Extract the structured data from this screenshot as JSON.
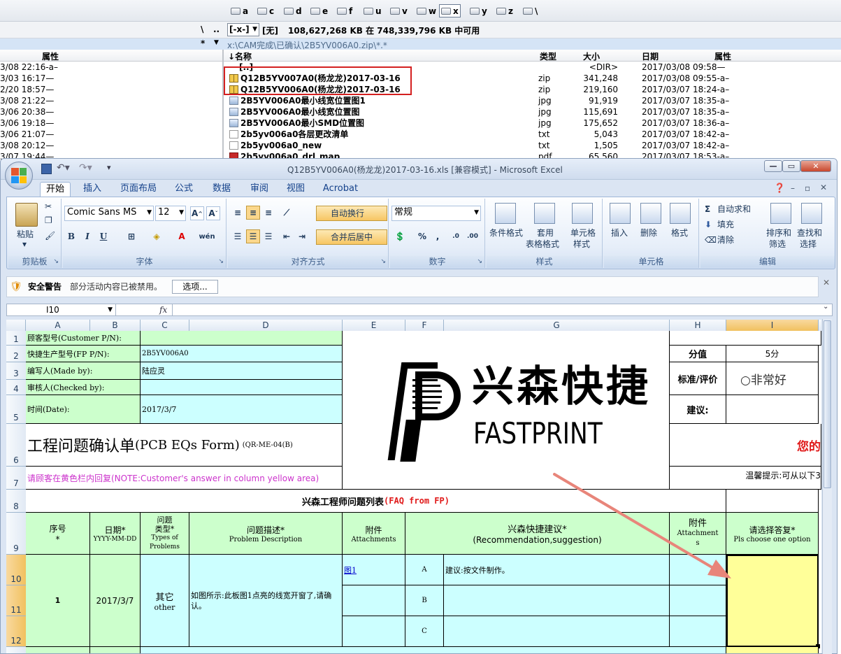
{
  "file_manager": {
    "drives": [
      "a",
      "c",
      "d",
      "e",
      "f",
      "u",
      "v",
      "w",
      "x",
      "y",
      "z",
      "\\"
    ],
    "selected_drive": "x",
    "left_path_labels": [
      "\\",
      "..",
      "*",
      "▼"
    ],
    "drive_selector": "[-x-]",
    "volume_label": "[无]",
    "free_space_text": "108,627,268 KB 在 748,339,796 KB 中可用",
    "current_path": "x:\\CAM完成\\已确认\\2B5YV006A0.zip\\*.*",
    "left_columns": {
      "attr": "属性"
    },
    "columns": {
      "name": "↓名称",
      "type": "类型",
      "size": "大小",
      "date": "日期",
      "attr": "属性"
    },
    "left_rows": [
      "3/08 22:16-a–",
      "3/03 16:17—",
      "2/20 18:57—",
      "3/08 21:22—",
      "3/06 20:38—",
      "3/06 19:18—",
      "3/06 21:07—",
      "3/08 20:12—",
      "3/07 19:44—"
    ],
    "rows": [
      {
        "name": "[..]",
        "type": "",
        "size": "<DIR>",
        "date": "2017/03/08 09:58—",
        "icon": "up"
      },
      {
        "name": "Q12B5YV007A0(杨龙龙)2017-03-16",
        "type": "zip",
        "size": "341,248",
        "date": "2017/03/08 09:55-a–",
        "icon": "zip"
      },
      {
        "name": "Q12B5YV006A0(杨龙龙)2017-03-16",
        "type": "zip",
        "size": "219,160",
        "date": "2017/03/07 18:24-a–",
        "icon": "zip"
      },
      {
        "name": "2B5YV006A0最小线宽位置图1",
        "type": "jpg",
        "size": "91,919",
        "date": "2017/03/07 18:35-a–",
        "icon": "jpg"
      },
      {
        "name": "2B5YV006A0最小线宽位置图",
        "type": "jpg",
        "size": "115,691",
        "date": "2017/03/07 18:35-a–",
        "icon": "jpg"
      },
      {
        "name": "2B5YV006A0最小SMD位置图",
        "type": "jpg",
        "size": "175,652",
        "date": "2017/03/07 18:36-a–",
        "icon": "jpg"
      },
      {
        "name": "2b5yv006a0各层更改清单",
        "type": "txt",
        "size": "5,043",
        "date": "2017/03/07 18:42-a–",
        "icon": "txt"
      },
      {
        "name": "2b5yv006a0_new",
        "type": "txt",
        "size": "1,505",
        "date": "2017/03/07 18:42-a–",
        "icon": "txt"
      },
      {
        "name": "2b5yv006a0_drl_map",
        "type": "pdf",
        "size": "65,560",
        "date": "2017/03/07 18:53-a–",
        "icon": "pdf"
      }
    ]
  },
  "excel": {
    "title": "Q12B5YV006A0(杨龙龙)2017-03-16.xls [兼容模式] - Microsoft Excel",
    "tabs": [
      "开始",
      "插入",
      "页面布局",
      "公式",
      "数据",
      "审阅",
      "视图",
      "Acrobat"
    ],
    "ribbon": {
      "clipboard": {
        "paste": "粘贴",
        "group": "剪贴板"
      },
      "font": {
        "name": "Comic Sans MS",
        "size": "12",
        "group": "字体"
      },
      "alignment": {
        "wrap": "自动换行",
        "merge": "合并后居中",
        "group": "对齐方式"
      },
      "number": {
        "format": "常规",
        "group": "数字"
      },
      "styles": {
        "cond": "条件格式",
        "table1": "套用",
        "table2": "表格格式",
        "cell1": "单元格",
        "cell2": "样式",
        "group": "样式"
      },
      "cells": {
        "insert": "插入",
        "delete": "删除",
        "format": "格式",
        "group": "单元格"
      },
      "editing": {
        "autosum": "自动求和",
        "fill": "填充",
        "clear": "清除",
        "sort1": "排序和",
        "sort2": "筛选",
        "find1": "查找和",
        "find2": "选择",
        "group": "编辑"
      }
    },
    "security": {
      "title": "安全警告",
      "message": "部分活动内容已被禁用。",
      "options": "选项..."
    },
    "name_box": "I10",
    "fx": "fx",
    "columns": [
      "A",
      "B",
      "C",
      "D",
      "E",
      "F",
      "G",
      "H",
      "I"
    ],
    "rows": [
      "1",
      "2",
      "3",
      "4",
      "5",
      "6",
      "7",
      "8",
      "9",
      "10",
      "11",
      "12"
    ],
    "cells": {
      "a1": "顾客型号(Customer P/N):",
      "a2": "快捷生产型号(FP P/N):",
      "c2": "2B5YV006A0",
      "a3": "编写人(Made by):",
      "c3": "陆应灵",
      "a4": "审核人(Checked by):",
      "a5": "时间(Date):",
      "c5": "2017/3/7",
      "title_main": "工程问题确认单",
      "title_en": "(PCB EQs Form)",
      "title_code": "(QR-ME-04(B)",
      "note7": "请顾客在黄色栏内回复(NOTE:Customer's answer in column yellow area)",
      "h1_score": "分值",
      "i1_score": "5分",
      "h2_std": "标准/评价",
      "i2_std": "○非常好",
      "h3_sugg": "建议:",
      "h6_red": "您的",
      "h7_tip": "温馨提示:可从以下3",
      "row8_title": "兴森工程师问题列表",
      "row8_title_en": "(FAQ from FP)",
      "hdr_seq1": "序号",
      "hdr_seq2": "*",
      "hdr_date1": "日期*",
      "hdr_date2": "YYYY-MM-DD",
      "hdr_type1": "问题",
      "hdr_type2": "类型*",
      "hdr_type3": "Types of",
      "hdr_type4": "Problems",
      "hdr_desc1": "问题描述*",
      "hdr_desc2": "Problem Description",
      "hdr_att1": "附件",
      "hdr_att2": "Attachments",
      "hdr_rec1": "兴森快捷建议*",
      "hdr_rec2": "(Recommendation,suggestion)",
      "hdr_att3": "附件",
      "hdr_att4": "Attachment",
      "hdr_att5": "s",
      "hdr_ans1": "请选择答复*",
      "hdr_ans2": "Pls choose one option",
      "r_seq": "1",
      "r_date": "2017/3/7",
      "r_type1": "其它",
      "r_type2": "other",
      "r_desc": "如图所示:此板图1点亮的线宽开窗了,请确认。",
      "r_att": "图1",
      "opt_a": "A",
      "opt_b": "B",
      "opt_c": "C",
      "sugg_a": "建议:按文件制作。"
    },
    "logo": {
      "cn": "兴森快捷",
      "en": "FASTPRINT"
    }
  },
  "colors": {
    "annotation_red": "#d42020",
    "arrow": "#e8857a",
    "light_green": "#ccffcc",
    "light_cyan": "#ccffff",
    "light_yellow": "#ffff99"
  }
}
